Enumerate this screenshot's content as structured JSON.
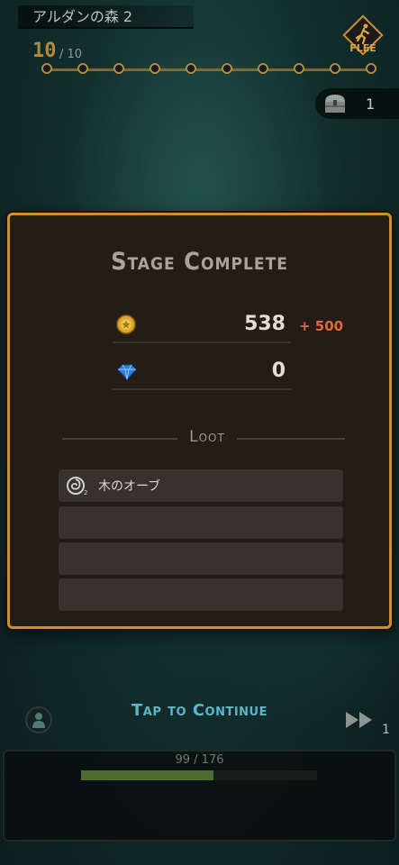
{
  "stage": {
    "title": "アルダンの森 2",
    "current": "10",
    "total": "/ 10",
    "dots": 10
  },
  "flee": {
    "label": "FLEE",
    "icon": "running-man-icon"
  },
  "chest": {
    "count": "1",
    "icon": "treasure-chest-icon"
  },
  "result": {
    "title": "Stage Complete",
    "coins": {
      "value": "538",
      "gain": "+ 500",
      "icon": "gold-coin-icon"
    },
    "gems": {
      "value": "0",
      "icon": "blue-gem-icon"
    },
    "loot_title": "Loot",
    "loot": [
      {
        "name": "木のオーブ",
        "icon": "wood-orb-icon"
      },
      {
        "name": ""
      },
      {
        "name": ""
      },
      {
        "name": ""
      }
    ]
  },
  "continue_label": "Tap to Continue",
  "fast_forward": {
    "count": "1",
    "icon": "fast-forward-icon"
  },
  "hp": {
    "text": "99 / 176",
    "fraction": 0.5625
  },
  "colors": {
    "accent": "#c98f35",
    "continue": "#5bb6c6",
    "gain": "#e0683a",
    "hp": "#4f6e2e"
  }
}
